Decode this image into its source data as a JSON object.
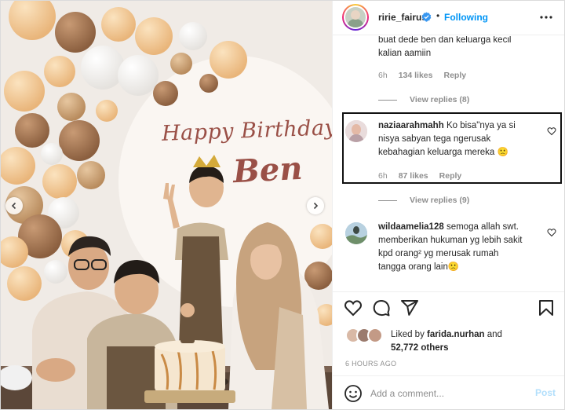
{
  "header": {
    "username": "ririe_fairus",
    "separator": "•",
    "follow_label": "Following",
    "verified_icon": "verified-badge-icon",
    "more_icon": "more-options-icon"
  },
  "photo": {
    "sign_line1": "Happy Birthday",
    "sign_line2": "Ben",
    "prev_icon": "chevron-left-icon",
    "next_icon": "chevron-right-icon"
  },
  "comments": [
    {
      "text_tail": "buat dede ben dan keluarga kecil kalian aamiin",
      "line1": "buat dede ben dan keluarga kecil",
      "line2": "kalian aamiin",
      "time": "6h",
      "likes": "134 likes",
      "reply": "Reply",
      "view_replies": "View replies (8)"
    },
    {
      "username": "naziaarahmahh",
      "line1": "Ko bisa\"nya ya si",
      "line2": "nisya sabyan tega ngerusak",
      "line3": "kebahagian keluarga mereka 🙁",
      "time": "6h",
      "likes": "87 likes",
      "reply": "Reply",
      "view_replies": "View replies (9)"
    },
    {
      "username": "wildaamelia128",
      "line1": "semoga allah swt.",
      "line2": "memberikan hukuman yg lebih sakit",
      "line3": "kpd orang² yg merusak rumah",
      "line4": "tangga orang lain🙁"
    }
  ],
  "actions": {
    "like_icon": "heart-icon",
    "comment_icon": "comment-bubble-icon",
    "share_icon": "paper-plane-icon",
    "save_icon": "bookmark-icon"
  },
  "likes": {
    "prefix": "Liked by",
    "user": "farida.nurhan",
    "and": "and",
    "count": "52,772 others"
  },
  "timestamp": "6 HOURS AGO",
  "add_comment": {
    "placeholder": "Add a comment...",
    "post_label": "Post",
    "emoji_icon": "emoji-smile-icon"
  },
  "colors": {
    "link_blue": "#0095f6",
    "post_disabled": "#b2dffc",
    "muted": "#8e8e8e",
    "text": "#262626"
  }
}
